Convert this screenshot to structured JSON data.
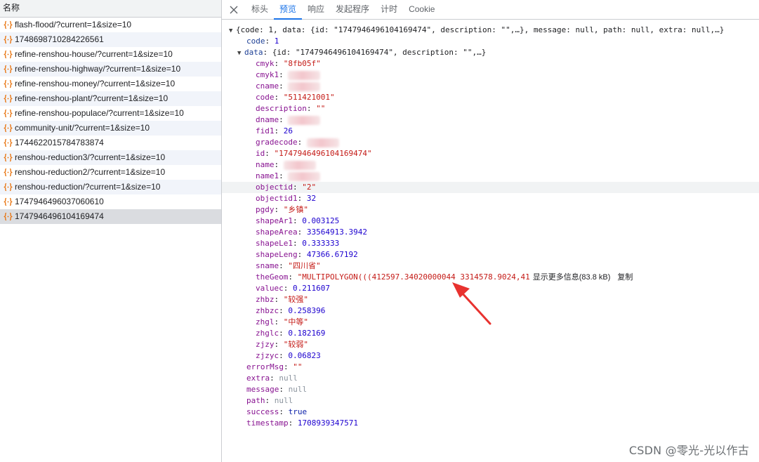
{
  "left_panel": {
    "header": "名称",
    "requests": [
      {
        "name": "flash-flood/?current=1&size=10",
        "selected": false
      },
      {
        "name": "1748698710284226561",
        "selected": false
      },
      {
        "name": "refine-renshou-house/?current=1&size=10",
        "selected": false
      },
      {
        "name": "refine-renshou-highway/?current=1&size=10",
        "selected": false
      },
      {
        "name": "refine-renshou-money/?current=1&size=10",
        "selected": false
      },
      {
        "name": "refine-renshou-plant/?current=1&size=10",
        "selected": false
      },
      {
        "name": "refine-renshou-populace/?current=1&size=10",
        "selected": false
      },
      {
        "name": "community-unit/?current=1&size=10",
        "selected": false
      },
      {
        "name": "1744622015784783874",
        "selected": false
      },
      {
        "name": "renshou-reduction3/?current=1&size=10",
        "selected": false
      },
      {
        "name": "renshou-reduction2/?current=1&size=10",
        "selected": false
      },
      {
        "name": "renshou-reduction/?current=1&size=10",
        "selected": false
      },
      {
        "name": "1747946496037060610",
        "selected": false
      },
      {
        "name": "1747946496104169474",
        "selected": true
      }
    ]
  },
  "tabs": [
    {
      "label": "标头",
      "active": false
    },
    {
      "label": "预览",
      "active": true
    },
    {
      "label": "响应",
      "active": false
    },
    {
      "label": "发起程序",
      "active": false
    },
    {
      "label": "计时",
      "active": false
    },
    {
      "label": "Cookie",
      "active": false
    }
  ],
  "preview": {
    "root_summary": "{code: 1, data: {id: \"1747946496104169474\", description: \"\",…}, message: null, path: null, extra: null,…}",
    "code": {
      "key": "code",
      "value": "1"
    },
    "data_summary": "{id: \"1747946496104169474\", description: \"\",…}",
    "data_fields": [
      {
        "key": "cmyk",
        "value": "\"8fb05f\"",
        "type": "string"
      },
      {
        "key": "cmyk1",
        "value": "",
        "type": "redacted"
      },
      {
        "key": "cname",
        "value": "",
        "type": "redacted"
      },
      {
        "key": "code",
        "value": "\"511421001\"",
        "type": "string"
      },
      {
        "key": "description",
        "value": "\"\"",
        "type": "string"
      },
      {
        "key": "dname",
        "value": "",
        "type": "redacted"
      },
      {
        "key": "fid1",
        "value": "26",
        "type": "number"
      },
      {
        "key": "gradecode",
        "value": "",
        "type": "redacted"
      },
      {
        "key": "id",
        "value": "\"1747946496104169474\"",
        "type": "string"
      },
      {
        "key": "name",
        "value": "",
        "type": "redacted"
      },
      {
        "key": "name1",
        "value": "",
        "type": "redacted"
      },
      {
        "key": "objectid",
        "value": "\"2\"",
        "type": "string",
        "highlight": true
      },
      {
        "key": "objectid1",
        "value": "32",
        "type": "number"
      },
      {
        "key": "pgdy",
        "value": "\"乡镇\"",
        "type": "string"
      },
      {
        "key": "shapeAr1",
        "value": "0.003125",
        "type": "number"
      },
      {
        "key": "shapeArea",
        "value": "33564913.3942",
        "type": "number"
      },
      {
        "key": "shapeLe1",
        "value": "0.333333",
        "type": "number"
      },
      {
        "key": "shapeLeng",
        "value": "47366.67192",
        "type": "number"
      },
      {
        "key": "sname",
        "value": "\"四川省\"",
        "type": "string"
      },
      {
        "key": "theGeom",
        "value": "\"MULTIPOLYGON(((412597.34020000044 3314578.9024,41",
        "type": "string",
        "more_label": "显示更多信息(83.8 kB)",
        "copy_label": "复制"
      },
      {
        "key": "valuec",
        "value": "0.211607",
        "type": "number"
      },
      {
        "key": "zhbz",
        "value": "\"较强\"",
        "type": "string"
      },
      {
        "key": "zhbzc",
        "value": "0.258396",
        "type": "number"
      },
      {
        "key": "zhgl",
        "value": "\"中等\"",
        "type": "string"
      },
      {
        "key": "zhglc",
        "value": "0.182169",
        "type": "number"
      },
      {
        "key": "zjzy",
        "value": "\"较弱\"",
        "type": "string"
      },
      {
        "key": "zjzyc",
        "value": "0.06823",
        "type": "number"
      }
    ],
    "tail_fields": [
      {
        "key": "errorMsg",
        "value": "\"\"",
        "type": "string"
      },
      {
        "key": "extra",
        "value": "null",
        "type": "null"
      },
      {
        "key": "message",
        "value": "null",
        "type": "null"
      },
      {
        "key": "path",
        "value": "null",
        "type": "null"
      },
      {
        "key": "success",
        "value": "true",
        "type": "bool"
      },
      {
        "key": "timestamp",
        "value": "1708939347571",
        "type": "number"
      }
    ]
  },
  "watermark": "CSDN @零光-光以作古",
  "icons": {
    "close": "close-icon",
    "request": "json-request-icon",
    "expand": "triangle-down-icon",
    "arrow": "annotation-arrow"
  },
  "colors": {
    "accent": "#1a73e8",
    "string": "#c41a16",
    "number": "#1c00cf",
    "key": "#881391",
    "arrow": "#e8322f"
  }
}
